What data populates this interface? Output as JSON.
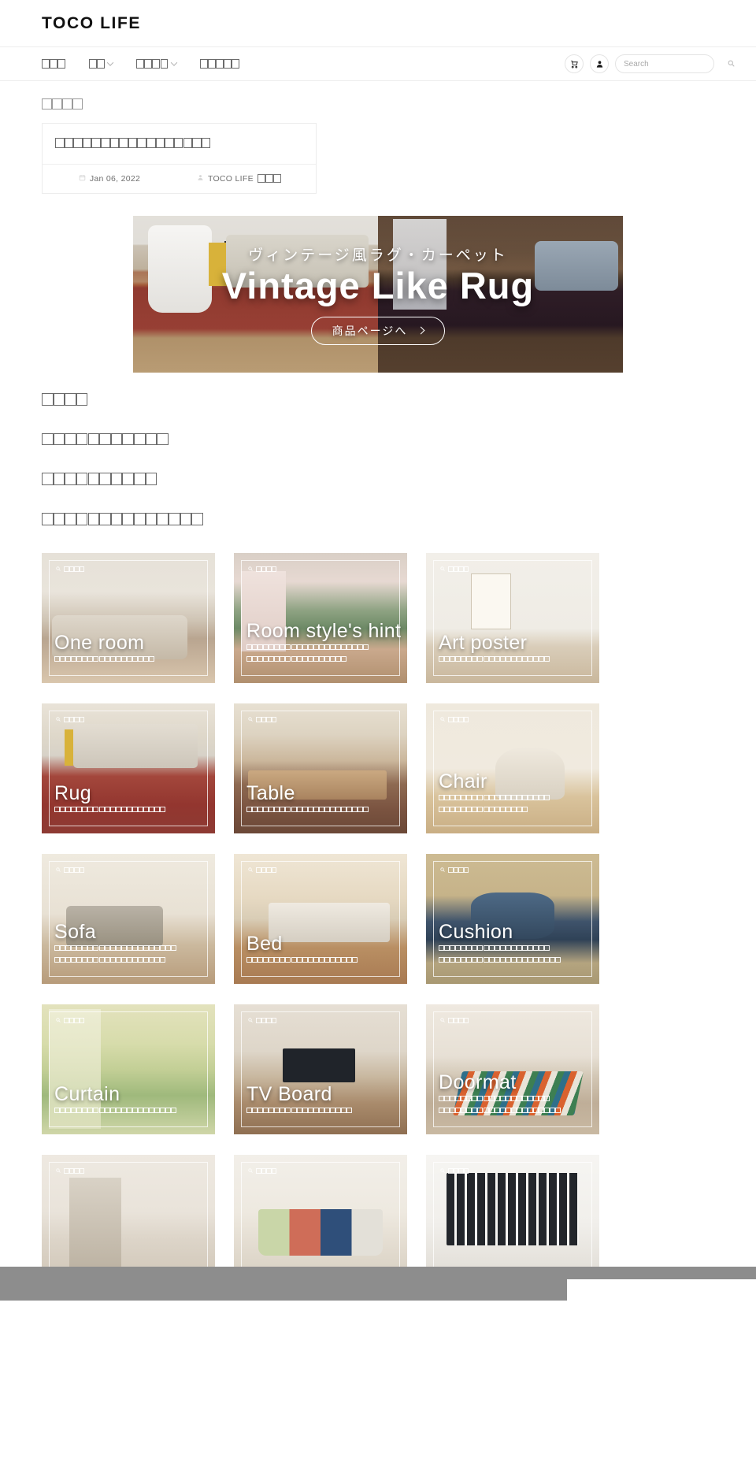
{
  "header": {
    "brand": "TOCO LIFE"
  },
  "nav": {
    "items": [
      {
        "name": "nav-home",
        "tofu": 3,
        "has_chevron": false
      },
      {
        "name": "nav-shop",
        "tofu": 2,
        "has_chevron": true
      },
      {
        "name": "nav-category",
        "tofu": 4,
        "has_chevron": true
      },
      {
        "name": "nav-guide",
        "tofu": 5,
        "has_chevron": false
      }
    ],
    "cart_icon": "cart-icon",
    "account_icon": "user-icon",
    "search_placeholder": "Search",
    "search_value": "",
    "search_icon": "search-icon"
  },
  "breadcrumb": {
    "tofu": 4
  },
  "article": {
    "title_tofu": 17,
    "date_icon": "calendar-icon",
    "date": "Jan 06, 2022",
    "author_icon": "user-icon",
    "author_text": "TOCO LIFE",
    "author_tofu": 3
  },
  "banner": {
    "subtitle": "ヴィンテージ風ラグ・カーペット",
    "title": "Vintage Like Rug",
    "cta_label": "商品ページへ",
    "cta_arrow": "chevron-right-icon"
  },
  "paragraphs": [
    {
      "tofu": 4
    },
    {
      "tofu": 11
    },
    {
      "tofu": 10
    },
    {
      "tofu": 14
    }
  ],
  "categories": [
    {
      "name": "one-room",
      "tag_tofu": 4,
      "title": "One room",
      "sub_tofu_lines": [
        18
      ],
      "photo": "p-oneroom"
    },
    {
      "name": "room-style-hint",
      "tag_tofu": 4,
      "title": "Room style's hint",
      "sub_tofu_lines": [
        22,
        18
      ],
      "photo": "p-hint"
    },
    {
      "name": "art-poster",
      "tag_tofu": 4,
      "title": "Art poster",
      "sub_tofu_lines": [
        20
      ],
      "photo": "p-poster"
    },
    {
      "name": "rug",
      "tag_tofu": 4,
      "title": "Rug",
      "sub_tofu_lines": [
        20
      ],
      "photo": "p-rug"
    },
    {
      "name": "table",
      "tag_tofu": 4,
      "title": "Table",
      "sub_tofu_lines": [
        22
      ],
      "photo": "p-table"
    },
    {
      "name": "chair",
      "tag_tofu": 4,
      "title": "Chair",
      "sub_tofu_lines": [
        20,
        16
      ],
      "photo": "p-chair"
    },
    {
      "name": "sofa",
      "tag_tofu": 4,
      "title": "Sofa",
      "sub_tofu_lines": [
        22,
        20
      ],
      "photo": "p-sofa"
    },
    {
      "name": "bed",
      "tag_tofu": 4,
      "title": "Bed",
      "sub_tofu_lines": [
        20
      ],
      "photo": "p-bed"
    },
    {
      "name": "cushion",
      "tag_tofu": 4,
      "title": "Cushion",
      "sub_tofu_lines": [
        20,
        22
      ],
      "photo": "p-cushion"
    },
    {
      "name": "curtain",
      "tag_tofu": 4,
      "title": "Curtain",
      "sub_tofu_lines": [
        22
      ],
      "photo": "p-curtain"
    },
    {
      "name": "tv-board",
      "tag_tofu": 4,
      "title": "TV Board",
      "sub_tofu_lines": [
        19
      ],
      "photo": "p-tvboard"
    },
    {
      "name": "doormat",
      "tag_tofu": 4,
      "title": "Doormat",
      "sub_tofu_lines": [
        20,
        22
      ],
      "photo": "p-doormat"
    },
    {
      "name": "shelf",
      "tag_tofu": 4,
      "title": "",
      "sub_tofu_lines": [],
      "photo": "p-shelf"
    },
    {
      "name": "mug",
      "tag_tofu": 4,
      "title": "",
      "sub_tofu_lines": [],
      "photo": "p-mug"
    },
    {
      "name": "window",
      "tag_tofu": 4,
      "title": "",
      "sub_tofu_lines": [],
      "photo": "p-window"
    }
  ]
}
